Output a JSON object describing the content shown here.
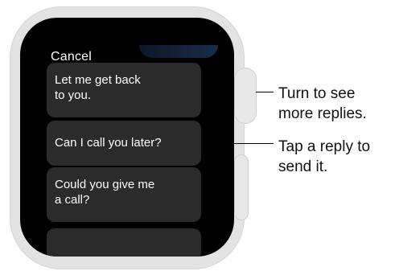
{
  "watch": {
    "cancel_label": "Cancel",
    "replies": [
      "Let me get back\nto you.",
      "Can I call you later?",
      "Could you give me\na call?",
      ""
    ]
  },
  "callouts": {
    "crown": "Turn to see\nmore replies.",
    "reply": "Tap a reply to\nsend it."
  },
  "colors": {
    "case": "#e3e3e3",
    "screen": "#000000",
    "card": "#2b2b2b",
    "text": "#ffffff"
  }
}
